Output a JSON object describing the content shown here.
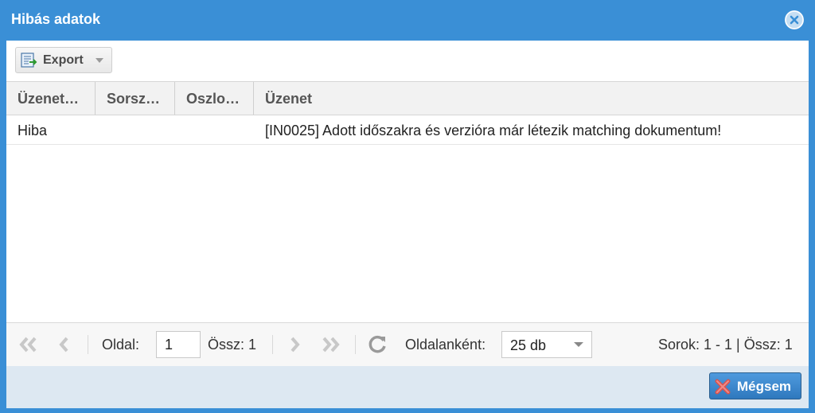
{
  "window": {
    "title": "Hibás adatok"
  },
  "toolbar": {
    "export_label": "Export"
  },
  "grid": {
    "columns": [
      "Üzenet…",
      "Sorsz…",
      "Oszlo…",
      "Üzenet"
    ],
    "rows": [
      {
        "type": "Hiba",
        "row_no": "",
        "column": "",
        "message": "[IN0025] Adott időszakra és verzióra már létezik matching dokumentum!"
      }
    ]
  },
  "pager": {
    "page_label": "Oldal:",
    "page_value": "1",
    "total_pages": "Össz: 1",
    "per_page_label": "Oldalanként:",
    "per_page_value": "25 db",
    "rows_info": "Sorok: 1 - 1 | Össz: 1"
  },
  "footer": {
    "cancel_label": "Mégsem"
  },
  "colors": {
    "title_bar": "#3a8fd6",
    "footer": "#dde8f2",
    "cancel_button": "#2f78bd"
  }
}
